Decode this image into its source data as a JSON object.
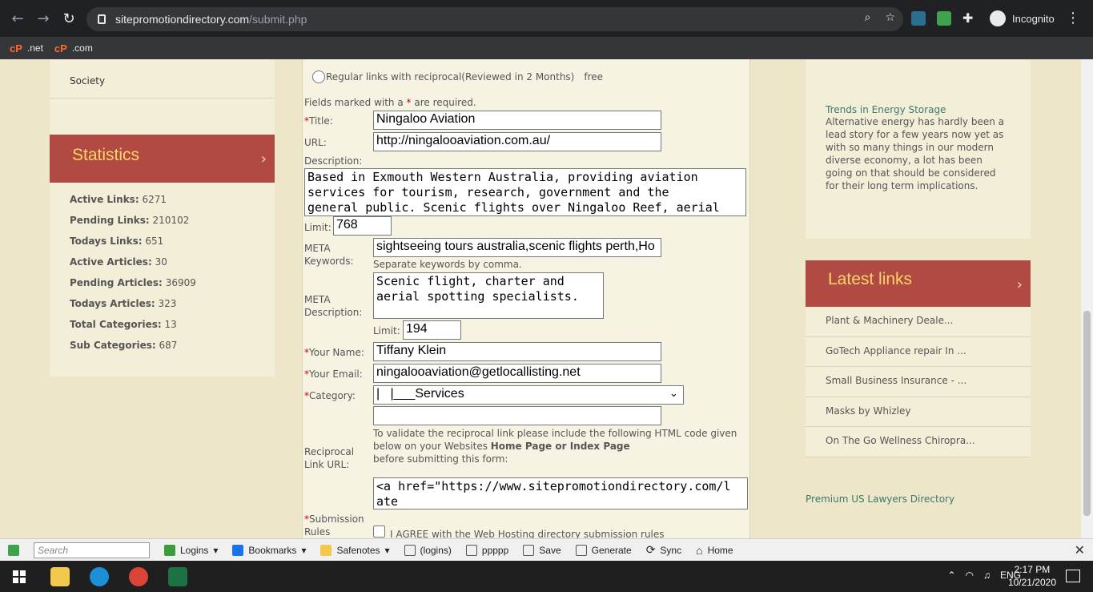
{
  "browser": {
    "url_host": "sitepromotiondirectory.com",
    "url_path": "/submit.php",
    "profile_label": "Incognito",
    "bookmarks": [
      {
        "label": ".net"
      },
      {
        "label": ".com"
      }
    ]
  },
  "left": {
    "society": "Society",
    "stats_title": "Statistics",
    "stats": [
      {
        "label": "Active Links:",
        "value": "6271"
      },
      {
        "label": "Pending Links:",
        "value": "210102"
      },
      {
        "label": "Todays Links:",
        "value": "651"
      },
      {
        "label": "Active Articles:",
        "value": "30"
      },
      {
        "label": "Pending Articles:",
        "value": "36909"
      },
      {
        "label": "Todays Articles:",
        "value": "323"
      },
      {
        "label": "Total Categories:",
        "value": "13"
      },
      {
        "label": "Sub Categories:",
        "value": "687"
      }
    ]
  },
  "form": {
    "regular_option": "Regular links with reciprocal(Reviewed in 2 Months)",
    "regular_price": "free",
    "required_note_pre": "Fields marked with a ",
    "required_note_star": "*",
    "required_note_post": " are required.",
    "title_label": "Title:",
    "title_value": "Ningaloo Aviation",
    "url_label": "URL:",
    "url_value": "http://ningalooaviation.com.au/",
    "description_label": "Description:",
    "description_value": "Based in Exmouth Western Australia, providing aviation services for tourism, research, government and the general public. Scenic flights over Ningaloo Reef, aerial",
    "limit_label": "Limit:",
    "description_limit": "768",
    "meta_keywords_label": "META Keywords:",
    "meta_keywords_value": "sightseeing tours australia,scenic flights perth,Ho",
    "keywords_hint": "Separate keywords by comma.",
    "meta_description_label": "META Description:",
    "meta_description_value": "Scenic flight, charter and aerial spotting specialists.",
    "meta_limit": "194",
    "name_label": "Your Name:",
    "name_value": "Tiffany Klein",
    "email_label": "Your Email:",
    "email_value": "ningalooaviation@getlocallisting.net",
    "category_label": "Category:",
    "category_value": "|   |___Services",
    "reciprocal_label": "Reciprocal Link URL:",
    "reciprocal_value": "",
    "reciprocal_hint_1": "To validate the reciprocal link please include the following HTML code given below on your Websites ",
    "reciprocal_hint_bold": "Home Page or Index Page",
    "reciprocal_hint_2": "before submitting this form:",
    "code_value": "<a href=\"https://www.sitepromotiondirectory.com/late",
    "rules_label": "Submission Rules",
    "agree_label": "I AGREE with the Web Hosting directory submission rules"
  },
  "right": {
    "trends_title": "Trends in Energy Storage",
    "trends_text": "Alternative energy has hardly been a lead story for a few years now yet as with so many things in our modern diverse economy, a lot has been going on that should be considered for their long term implications.",
    "latest_title": "Latest links",
    "latest": [
      "Plant & Machinery Deale...",
      "GoTech Appliance repair In ...",
      "Small Business Insurance - ...",
      "Masks by Whizley",
      "On The Go Wellness Chiropra..."
    ],
    "premium": "Premium US Lawyers Directory"
  },
  "toolbar": {
    "search_placeholder": "Search",
    "items": [
      "Logins",
      "Bookmarks",
      "Safenotes",
      "(logins)",
      "ppppp",
      "Save",
      "Generate",
      "Sync",
      "Home"
    ]
  },
  "taskbar": {
    "lang": "ENG",
    "time": "2:17 PM",
    "date": "10/21/2020"
  }
}
